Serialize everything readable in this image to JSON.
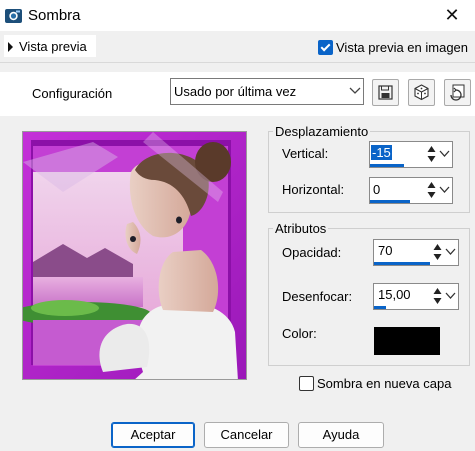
{
  "window": {
    "title": "Sombra",
    "close_glyph": "✕"
  },
  "preview_section": {
    "label": "Vista previa",
    "show_in_image_label": "Vista previa en imagen",
    "show_in_image_checked": true
  },
  "config": {
    "label": "Configuración",
    "preset_value": "Usado por última vez",
    "save_icon": "floppy-disk-icon",
    "random_icon": "dice-icon",
    "reset_icon": "reset-icon"
  },
  "offset_group": {
    "title": "Desplazamiento",
    "vertical_label": "Vertical:",
    "vertical_value": "-15",
    "horizontal_label": "Horizontal:",
    "horizontal_value": "0"
  },
  "attributes_group": {
    "title": "Atributos",
    "opacity_label": "Opacidad:",
    "opacity_value": "70",
    "blur_label": "Desenfocar:",
    "blur_value": "15,00",
    "color_label": "Color:",
    "color_value": "#000000"
  },
  "shadow_new_layer": {
    "label": "Sombra en nueva capa",
    "checked": false
  },
  "buttons": {
    "ok": "Aceptar",
    "cancel": "Cancelar",
    "help": "Ayuda"
  },
  "colors": {
    "accent": "#0a64c8",
    "preview_bg": "#b020c8"
  }
}
